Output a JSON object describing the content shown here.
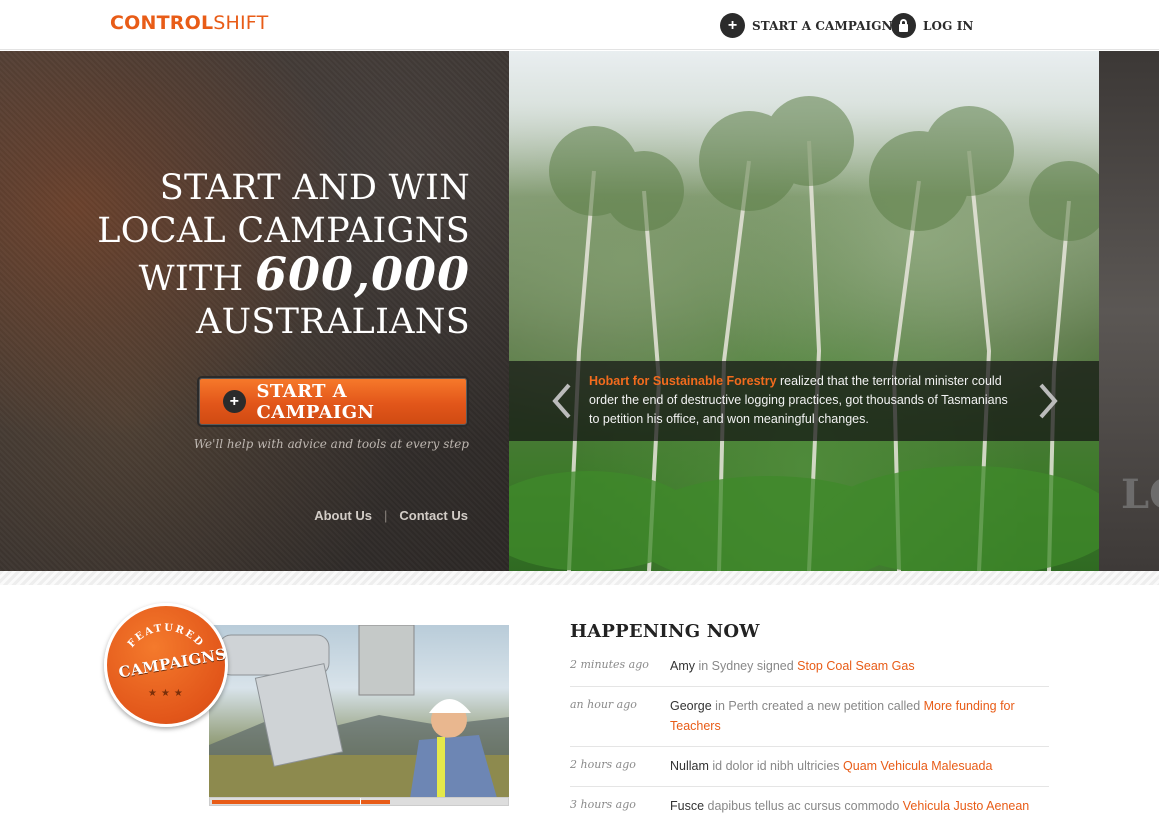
{
  "header": {
    "logo_part1": "CONTROL",
    "logo_part2": "SHIFT",
    "nav_start_label": "START A CAMPAIGN",
    "nav_login_label": "LOG IN"
  },
  "hero": {
    "headline_line1": "START AND WIN",
    "headline_line2": "LOCAL CAMPAIGNS",
    "headline_line3_prefix": "WITH",
    "headline_number": "600,000",
    "headline_line4": "AUSTRALIANS",
    "cta_label": "START A CAMPAIGN",
    "cta_subtext": "We'll help with advice and tools at every step",
    "footer_links": [
      "About Us",
      "Contact Us"
    ],
    "slide_caption": {
      "highlight": "Hobart for Sustainable Forestry",
      "text": " realized that the territorial minister could order the end of destructive logging practices, got thousands of Tasmanians to petition his office, and won meaningful changes."
    }
  },
  "featured": {
    "badge_top": "FEATURED",
    "badge_main": "CAMPAIGNS",
    "progress_fraction": 0.6
  },
  "happening_now": {
    "title": "HAPPENING NOW",
    "items": [
      {
        "time": "2 minutes ago",
        "who": "Amy",
        "action": " in Sydney signed ",
        "campaign": "Stop Coal Seam Gas"
      },
      {
        "time": "an hour ago",
        "who": "George",
        "action": " in Perth created a new petition called ",
        "campaign": "More funding for Teachers"
      },
      {
        "time": "2 hours ago",
        "who": "Nullam",
        "action": " id dolor id nibh ultricies ",
        "campaign": "Quam Vehicula Malesuada"
      },
      {
        "time": "3 hours ago",
        "who": "Fusce",
        "action": " dapibus tellus ac cursus commodo ",
        "campaign": "Vehicula Justo Aenean"
      }
    ]
  },
  "colors": {
    "accent": "#e85c17",
    "dark": "#2b2b2b"
  }
}
